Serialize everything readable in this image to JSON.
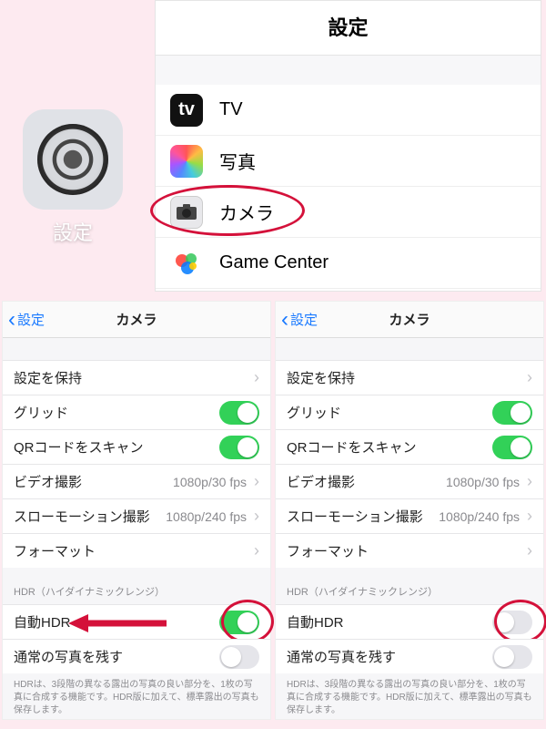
{
  "app_icon": {
    "label": "設定"
  },
  "main_panel": {
    "title": "設定",
    "rows": [
      {
        "icon": "tv-icon",
        "label": "TV"
      },
      {
        "icon": "photos-icon",
        "label": "写真"
      },
      {
        "icon": "camera-icon",
        "label": "カメラ"
      },
      {
        "icon": "gc-icon",
        "label": "Game Center"
      }
    ]
  },
  "camera_panel": {
    "back_label": "設定",
    "title": "カメラ",
    "rows_main": [
      {
        "label": "設定を保持",
        "type": "chevron"
      },
      {
        "label": "グリッド",
        "type": "toggle",
        "on": true
      },
      {
        "label": "QRコードをスキャン",
        "type": "toggle",
        "on": true
      },
      {
        "label": "ビデオ撮影",
        "type": "value-chevron",
        "value": "1080p/30 fps"
      },
      {
        "label": "スローモーション撮影",
        "type": "value-chevron",
        "value": "1080p/240 fps"
      },
      {
        "label": "フォーマット",
        "type": "chevron"
      }
    ],
    "hdr_section_label": "HDR（ハイダイナミックレンジ）",
    "hdr_rows_left": [
      {
        "label": "自動HDR",
        "type": "toggle",
        "on": true
      },
      {
        "label": "通常の写真を残す",
        "type": "toggle",
        "on": false
      }
    ],
    "hdr_rows_right": [
      {
        "label": "自動HDR",
        "type": "toggle",
        "on": false
      },
      {
        "label": "通常の写真を残す",
        "type": "toggle",
        "on": false
      }
    ],
    "hdr_note": "HDRは、3段階の異なる露出の写真の良い部分を、1枚の写真に合成する機能です。HDR版に加えて、標準露出の写真も保存します。"
  }
}
